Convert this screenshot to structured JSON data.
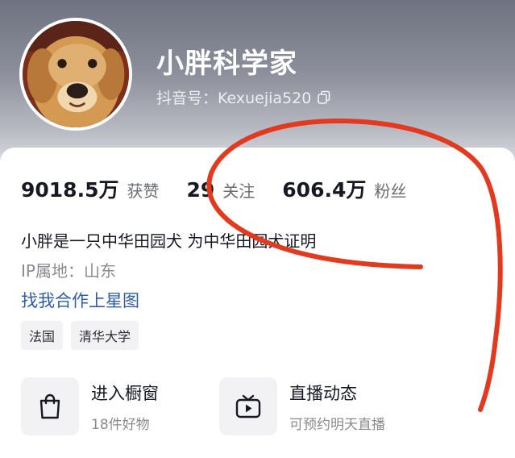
{
  "profile": {
    "nickname": "小胖科学家",
    "douyin_id": "抖音号：Kexuejia520",
    "avatar_icon": "golden-puppy-avatar"
  },
  "stats": [
    {
      "value": "9018.5万",
      "label": "获赞"
    },
    {
      "value": "29",
      "label": "关注"
    },
    {
      "value": "606.4万",
      "label": "粉丝"
    }
  ],
  "bio": "小胖是一只中华田园犬  为中华田园犬证明",
  "ip_location": "IP属地：山东",
  "star_map_link": "找我合作上星图",
  "tags": [
    "法国",
    "清华大学"
  ],
  "entries": [
    {
      "title": "进入橱窗",
      "subtitle": "18件好物",
      "icon": "shopping-bag-icon"
    },
    {
      "title": "直播动态",
      "subtitle": "可预约明天直播",
      "icon": "tv-play-icon"
    }
  ],
  "colors": {
    "annotation": "#e2391f",
    "link": "#2c5faa"
  }
}
